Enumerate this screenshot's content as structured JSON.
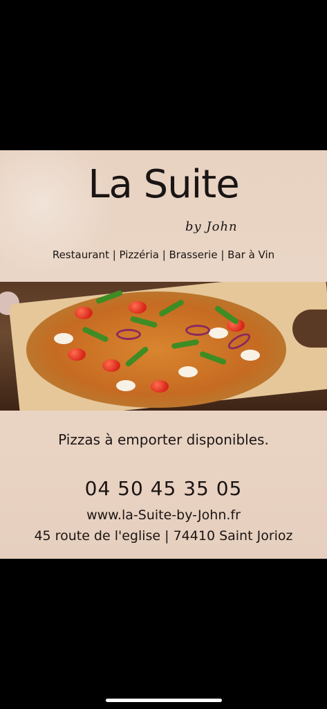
{
  "flyer": {
    "title": "La Suite",
    "subtitle": "by John",
    "services": "Restaurant | Pizzéria | Brasserie | Bar à Vin",
    "image": "pizza-photo",
    "tagline": "Pizzas à emporter disponibles.",
    "phone": "04 50 45 35 05",
    "website": "www.la-Suite-by-John.fr",
    "address": "45 route de l'eglise | 74410 Saint Jorioz"
  },
  "colors": {
    "background": "#000000",
    "flyer_bg": "#e9d3c3",
    "text": "#1a1514"
  }
}
